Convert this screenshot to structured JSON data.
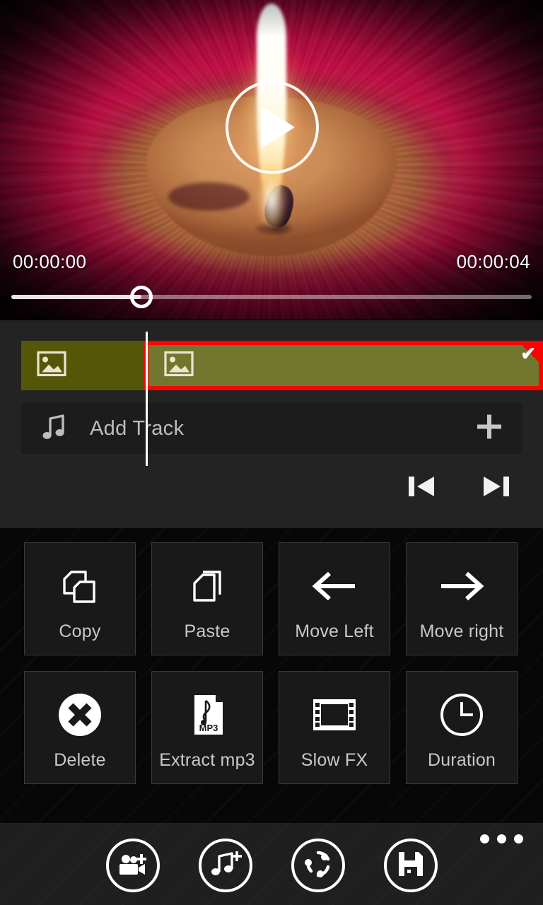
{
  "preview": {
    "play_button": "play-icon",
    "scene": "burning red candle with flame",
    "progress_percent": 25
  },
  "seek": {
    "current_time": "00:00:00",
    "total_time": "00:00:04"
  },
  "timeline": {
    "clips": [
      {
        "name": "clip-1",
        "icon": "image-icon",
        "selected": false
      },
      {
        "name": "clip-2",
        "icon": "image-icon",
        "selected": true,
        "check": "✔"
      }
    ],
    "add_track": {
      "icon": "music-note-icon",
      "label": "Add Track",
      "plus": "plus-icon"
    },
    "nav": {
      "prev": "skip-previous-icon",
      "next": "skip-next-icon"
    }
  },
  "actions": [
    {
      "label": "Copy",
      "icon": "copy-icon"
    },
    {
      "label": "Paste",
      "icon": "paste-icon"
    },
    {
      "label": "Move Left",
      "icon": "arrow-left-icon"
    },
    {
      "label": "Move right",
      "icon": "arrow-right-icon"
    },
    {
      "label": "Delete",
      "icon": "delete-circle-x-icon"
    },
    {
      "label": "Extract mp3",
      "icon": "mp3-file-icon",
      "badge": "MP3"
    },
    {
      "label": "Slow FX",
      "icon": "film-strip-icon"
    },
    {
      "label": "Duration",
      "icon": "clock-icon"
    }
  ],
  "appbar": {
    "buttons": [
      {
        "name": "add-video-button",
        "icon": "video-camera-plus-icon"
      },
      {
        "name": "add-music-button",
        "icon": "music-note-plus-icon"
      },
      {
        "name": "transition-button",
        "icon": "circular-arrows-icon"
      },
      {
        "name": "save-button",
        "icon": "floppy-disk-icon"
      }
    ],
    "more": "more-options-ellipsis"
  },
  "colors": {
    "selection_red": "#ff0000",
    "clip_olive_selected": "#73762f",
    "clip_olive": "#565609",
    "timeline_bg": "#232323",
    "tile_bg": "#191919"
  }
}
